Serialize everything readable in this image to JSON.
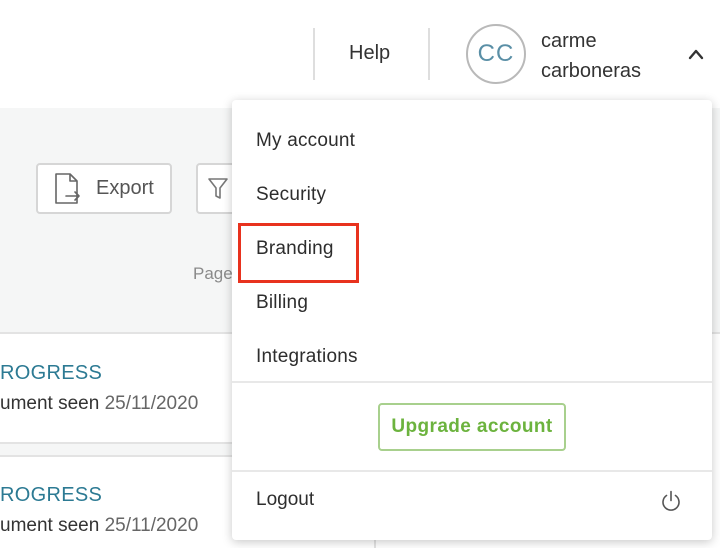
{
  "header": {
    "help_label": "Help",
    "avatar_initials": "CC",
    "user_first_name": "carme",
    "user_last_name": "carboneras"
  },
  "toolbar": {
    "export_label": "Export",
    "page_label": "Page"
  },
  "documents": [
    {
      "status": "ROGRESS",
      "seen_label": "ument seen",
      "date": "25/11/2020"
    },
    {
      "status": "ROGRESS",
      "seen_label": "ument seen",
      "date": "25/11/2020"
    }
  ],
  "user_menu": {
    "items": [
      {
        "label": "My account"
      },
      {
        "label": "Security"
      },
      {
        "label": "Branding"
      },
      {
        "label": "Billing"
      },
      {
        "label": "Integrations"
      }
    ],
    "upgrade_label": "Upgrade account",
    "logout_label": "Logout"
  },
  "colors": {
    "accent_teal": "#2c7a93",
    "upgrade_green": "#6cb33e",
    "highlight_red": "#e8321e",
    "panel_gray": "#f5f6f6"
  },
  "icons": {
    "export": "document-export-icon",
    "filter": "funnel-icon",
    "chevron": "chevron-up-icon",
    "logout": "power-icon"
  }
}
